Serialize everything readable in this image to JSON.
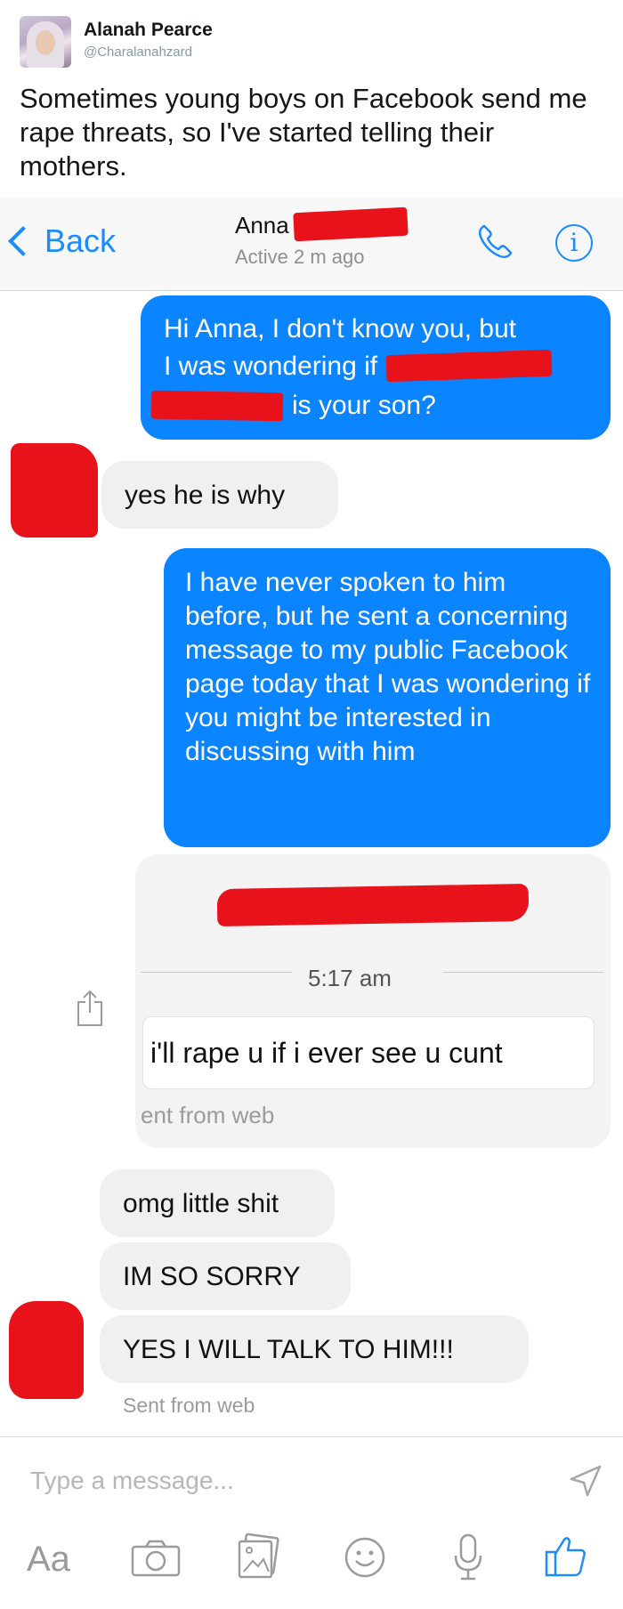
{
  "tweet": {
    "author_name": "Alanah Pearce",
    "author_handle": "@Charalanahzard",
    "text": "Sometimes young boys on Facebook send me rape threats, so I've started telling their mothers."
  },
  "messenger": {
    "nav": {
      "back_label": "Back",
      "contact_name": "Anna",
      "contact_status": "Active 2 m ago"
    },
    "messages": [
      {
        "dir": "out",
        "lines": [
          "Hi Anna, I don't know you, but",
          "I was wondering if",
          "is your son?"
        ]
      },
      {
        "dir": "in",
        "text": "yes he is why"
      },
      {
        "dir": "out",
        "text": "I have never spoken to him before, but he sent a concerning message to my public Facebook page today that I was wondering if you might be interested in discussing with him"
      }
    ],
    "shared_card": {
      "time": "5:17 am",
      "quote": "i'll rape u if i ever see u cunt",
      "sent_from": "ent from web"
    },
    "replies": [
      "omg little shit",
      "IM SO SORRY",
      "YES I WILL TALK TO HIM!!!"
    ],
    "sent_from_web": "Sent from web",
    "composer": {
      "placeholder": "Type a message...",
      "aa_label": "Aa"
    },
    "icons": [
      "send-icon",
      "camera-icon",
      "photo-icon",
      "emoji-icon",
      "microphone-icon",
      "like-icon",
      "phone-icon",
      "info-icon",
      "share-icon"
    ],
    "colors": {
      "accent": "#0a84ff",
      "redaction": "#e8121b",
      "incoming_bubble": "#f0f0f0"
    }
  }
}
